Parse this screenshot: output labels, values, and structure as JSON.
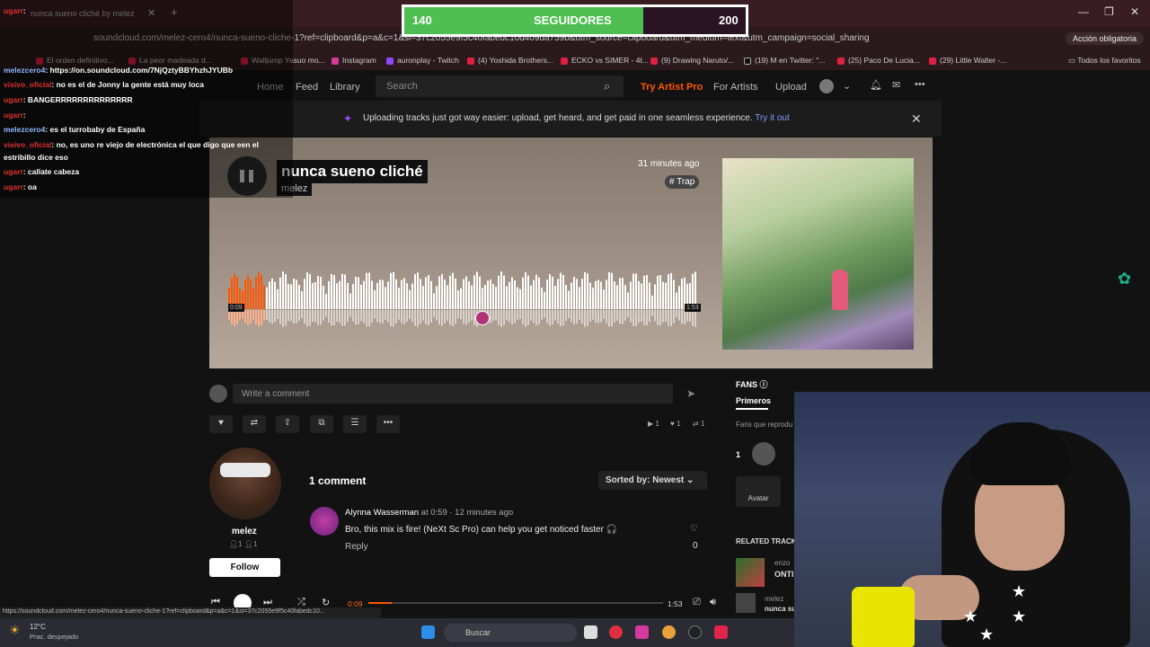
{
  "browser": {
    "tab_title": "nunca sueno cliché by melez",
    "url": "soundcloud.com/melez-cero4/nunca-sueno-cliche-1?ref=clipboard&p=a&c=1&si=37c2055e9f5c40fabedc10d409da759b&utm_source=clipboard&utm_medium=text&utm_campaign=social_sharing",
    "profile_button": "Acción obligatoria",
    "bookmarks": [
      "El orden definitivo...",
      "La peor madeada d...",
      "Walljump Yasuo mo...",
      "Instagram",
      "auronplay - Twitch",
      "(4) Yoshida Brothers...",
      "ECKO vs SIMER - 4t...",
      "(9) Drawing Naruto/...",
      "(19) M en Twitter: \"...",
      "(25) Paco De Lucia...",
      "(29) Little Walter -..."
    ],
    "all_bookmarks": "Todos los favoritos",
    "status_url": "https://soundcloud.com/melez-cero4/nunca-sueno-cliche-1?ref=clipboard&p=a&c=1&si=37c2055e9f5c40fabedc10..."
  },
  "nav": {
    "home": "Home",
    "feed": "Feed",
    "library": "Library",
    "search_placeholder": "Search",
    "try_artist_pro": "Try Artist Pro",
    "for_artists": "For Artists",
    "upload": "Upload"
  },
  "banner": {
    "text": "Uploading tracks just got way easier: upload, get heard, and get paid in one seamless experience.",
    "link": "Try it out"
  },
  "track": {
    "title": "nunca sueno cliché",
    "artist": "melez",
    "posted": "31 minutes ago",
    "genre": "# Trap",
    "time_current": "0:09",
    "time_total": "1:53",
    "progress": 0.08
  },
  "comment_box": {
    "placeholder": "Write a comment"
  },
  "stats": {
    "plays": "1",
    "likes": "1",
    "reposts": "1"
  },
  "artist_panel": {
    "name": "melez",
    "followers": "1",
    "following": "1",
    "follow_label": "Follow"
  },
  "comments": {
    "count_label": "1 comment",
    "sort_label": "Sorted by: Newest",
    "items": [
      {
        "user": "Alynna Wasserman",
        "at": "at",
        "timestamp": "0:59",
        "ago": "· 12 minutes ago",
        "text": "Bro, this mix is fire! (NeXt Sc Pro) can help you get noticed faster 🎧",
        "reply": "Reply",
        "likes": "0"
      }
    ]
  },
  "fans": {
    "title": "FANS",
    "tab": "Primeros",
    "desc": "Fans que reprodu",
    "rank": "1",
    "avatar_label": "Avatar"
  },
  "related": {
    "title": "RELATED TRACK",
    "items": [
      {
        "user": "enzo",
        "title": "ONTI"
      },
      {
        "user": "melez",
        "title": "nunca su"
      }
    ]
  },
  "player": {
    "current": "0:09",
    "total": "1:53"
  },
  "taskbar": {
    "temp": "12°C",
    "weather": "Prac. despejado",
    "search": "Buscar"
  },
  "overlay": {
    "follow_goal": {
      "current": "140",
      "label": "SEGUIDORES",
      "goal": "200",
      "progress": 0.7
    },
    "chat": [
      {
        "user": "ugarr",
        "msg": ":"
      },
      {
        "user": "melezcero4",
        "msg": ": https://on.soundcloud.com/7NjQztyBBYhzhJYUBb"
      },
      {
        "user": "visivo_oficial",
        "msg": ": no es el de Jonny la gente está muy loca"
      },
      {
        "user": "ugarr",
        "msg": ": BANGERRRRRRRRRRRRRR"
      },
      {
        "user": "ugarr",
        "msg": ":"
      },
      {
        "user": "melezcero4",
        "msg": ": es el turrobaby de España"
      },
      {
        "user": "visivo_oficial",
        "msg": ": no, es uno re viejo de electrónica el que digo que een el"
      },
      {
        "user": "",
        "msg": "estribillo dice eso"
      },
      {
        "user": "ugarr",
        "msg": ": callate cabeza"
      },
      {
        "user": "ugarr",
        "msg": ": oa"
      }
    ]
  },
  "colors": {
    "accent": "#ff5500",
    "goal_fill": "#4fbe52",
    "banner_link": "#7d9dff"
  }
}
